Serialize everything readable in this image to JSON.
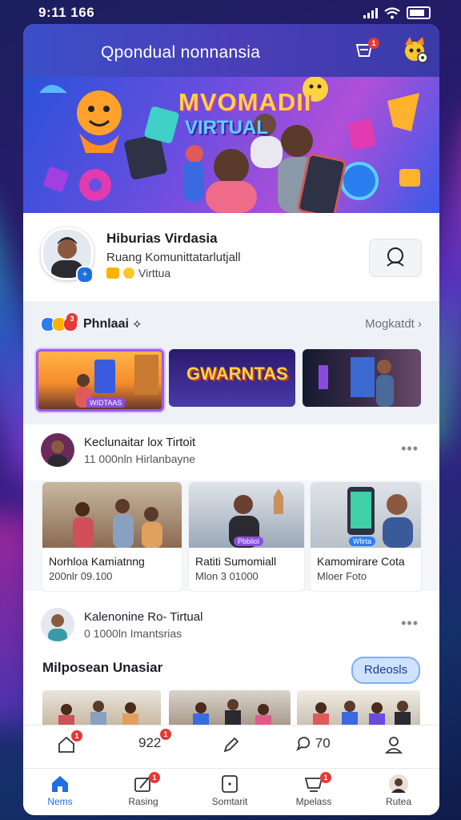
{
  "status_bar": {
    "time": "9:11 166"
  },
  "header": {
    "title": "Qpondual nonnansia",
    "inbox_badge": "1"
  },
  "banner": {
    "line1": "MVOMADII",
    "line2": "VIRTUAL"
  },
  "profile": {
    "name": "Hiburias Virdasia",
    "subtitle": "Ruang Komunittatarlutjall",
    "meta": "Virttua"
  },
  "highlights": {
    "badge_count": "3",
    "title": "Phnlaai",
    "more_label": "Mogkatdt",
    "cards": [
      {
        "label": "WIDTAAS"
      },
      {
        "label": "GWARNTAS"
      },
      {
        "label": ""
      }
    ]
  },
  "post1": {
    "name": "Keclunaitar lox Tirtoit",
    "subtitle": "11 000nln  Hirlanbayne",
    "more": "•••",
    "tiles": [
      {
        "title": "Norhloa Kamiatnng",
        "meta": "200nlr  09.100"
      },
      {
        "title": "Ratiti Sumomiall",
        "meta": "Mlon 3 01000"
      },
      {
        "title": "Kamomirare Cota",
        "meta": "Mloer  Foto"
      }
    ],
    "tile_badges": [
      "",
      "Pbbliol",
      "Wlirta"
    ]
  },
  "post2": {
    "name": "Kalenonine Ro- Tirtual",
    "subtitle": "0 1000ln  Imantsrias",
    "more": "•••"
  },
  "featured": {
    "title": "Milposean Unasiar",
    "button": "Rdeosls"
  },
  "toolbar": {
    "items": [
      {
        "icon": "home-icon",
        "label": "",
        "badge": "1"
      },
      {
        "icon": "",
        "label": "922",
        "badge": "1"
      },
      {
        "icon": "pen-icon",
        "label": "",
        "badge": ""
      },
      {
        "icon": "chat-icon",
        "label": "70",
        "badge": ""
      },
      {
        "icon": "user-icon",
        "label": "",
        "badge": ""
      }
    ]
  },
  "nav": {
    "items": [
      {
        "label": "Nems",
        "icon": "home-icon",
        "active": true,
        "badge": ""
      },
      {
        "label": "Rasing",
        "icon": "edit-icon",
        "active": false,
        "badge": "1"
      },
      {
        "label": "Somtarit",
        "icon": "bookmark-icon",
        "active": false,
        "badge": ""
      },
      {
        "label": "Mpelass",
        "icon": "people-icon",
        "active": false,
        "badge": "1"
      },
      {
        "label": "Rutea",
        "icon": "profile-icon",
        "active": false,
        "badge": ""
      }
    ]
  },
  "colors": {
    "accent": "#1e6fe0",
    "header_start": "#3b4fc8",
    "badge": "#e53935",
    "banner_text": "#ffd23f"
  }
}
